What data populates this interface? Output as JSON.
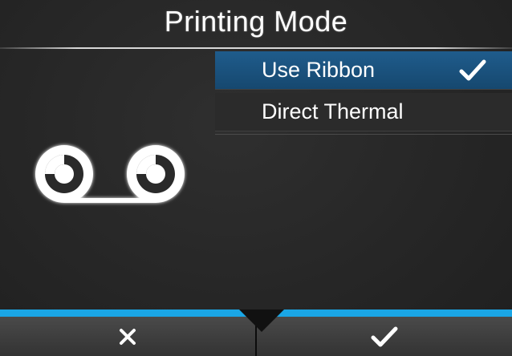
{
  "header": {
    "title": "Printing Mode"
  },
  "menu": {
    "items": [
      {
        "label": "Use Ribbon",
        "selected": true,
        "checked_icon": "checkmark-icon"
      },
      {
        "label": "Direct Thermal",
        "selected": false
      }
    ]
  },
  "graphic": {
    "icon": "ribbon-reels-icon"
  },
  "footer": {
    "cancel_icon": "close-icon",
    "confirm_icon": "checkmark-icon"
  },
  "colors": {
    "accent": "#1aa6e6",
    "selected_item": "#1f5c8c",
    "background": "#262626",
    "text": "#ffffff"
  }
}
